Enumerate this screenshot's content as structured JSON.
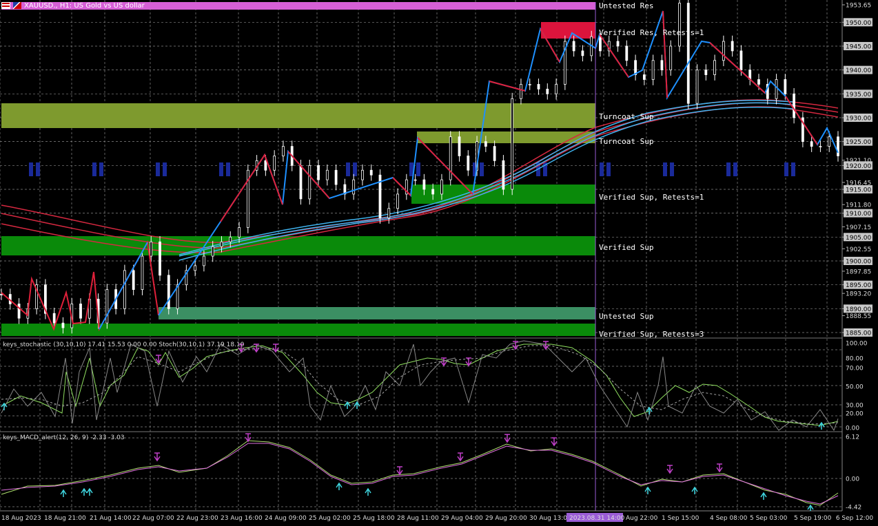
{
  "header": {
    "symbol_text": "XAUUSD., H1:  US Gold vs US dollar"
  },
  "stochastic_label": "keys_stochastic (30,10,10) 17.41 15.53 0.00 0.00  Stoch(30,10,1) 37.19 18.10",
  "macd_label": "keys_MACD_alert(12, 26, 9) -2.33 -3.03",
  "colors": {
    "up_line": "#1e90ff",
    "down_line": "#e0203a",
    "verified_sup": "#0a8a0a",
    "turncoat": "#7e9a2e",
    "untested_sup": "#3b8f63",
    "verified_res": "#dc143c",
    "untested_res": "#d65fd6"
  },
  "zone_labels": {
    "untested_res": "Untested Res",
    "verified_res": "Verified Res, Retests=1",
    "turncoat_1": "Turncoat Sup",
    "turncoat_2": "Turncoat Sup",
    "verified_sup_r1": "Verified Sup, Retests=1",
    "verified_sup": "Verified Sup",
    "untested_sup": "Untested Sup",
    "verified_sup_r3": "Verified Sup, Retests=3"
  },
  "price_axis": [
    "1953.65",
    "1950.00",
    "1945.00",
    "1940.00",
    "1935.00",
    "1930.00",
    "1925.00",
    "1921.10",
    "1920.00",
    "1916.45",
    "1915.00",
    "1911.80",
    "1910.00",
    "1907.15",
    "1905.00",
    "1902.55",
    "1900.00",
    "1897.85",
    "1895.00",
    "1893.20",
    "1890.00",
    "1888.55",
    "1885.00"
  ],
  "highlighted_prices": [
    "1950.00",
    "1945.00",
    "1940.00",
    "1935.00",
    "1930.00",
    "1925.00",
    "1920.00",
    "1915.00",
    "1910.00",
    "1905.00",
    "1900.00",
    "1895.00",
    "1890.00",
    "1885.00"
  ],
  "stoch_axis": [
    "100.00",
    "80.00",
    "70.00",
    "50.00",
    "30.00",
    "20.00",
    "0.00"
  ],
  "macd_axis": [
    "6.12",
    "0.00",
    "-4.42"
  ],
  "time_axis": [
    "18 Aug 2023",
    "18 Aug 21:00",
    "21 Aug 14:00",
    "22 Aug 07:00",
    "22 Aug 23:00",
    "23 Aug 16:00",
    "24 Aug 09:00",
    "25 Aug 02:00",
    "25 Aug 18:00",
    "28 Aug 11:00",
    "29 Aug 04:00",
    "29 Aug 20:00",
    "30 Aug 13:00",
    "2023.08.31 14:00",
    "Aug 22:00",
    "1 Sep 15:00",
    "4 Sep 08:00",
    "5 Sep 03:00",
    "5 Sep 19:00",
    "6 Sep 12:00"
  ],
  "cursor_time": "2023.08.31 14:00",
  "price_series": [
    1893,
    1891,
    1888,
    1890,
    1895,
    1889,
    1887,
    1886,
    1891,
    1888,
    1892,
    1887,
    1894,
    1890,
    1898,
    1894,
    1901,
    1904,
    1897,
    1890,
    1895,
    1898,
    1899,
    1901,
    1903,
    1904,
    1905,
    1907,
    1919,
    1921,
    1919,
    1922,
    1924,
    1920,
    1913,
    1920,
    1917,
    1919,
    1916,
    1914,
    1917,
    1919,
    1918,
    1909,
    1911,
    1914,
    1917,
    1917,
    1915,
    1914,
    1917,
    1926,
    1922,
    1919,
    1925,
    1924,
    1921,
    1915,
    1934,
    1937,
    1937,
    1936,
    1935,
    1937,
    1946,
    1944,
    1943,
    1947,
    1944,
    1946,
    1945,
    1942,
    1939,
    1938,
    1942,
    1940,
    1945,
    1954,
    1933,
    1940,
    1939,
    1942,
    1946,
    1944,
    1940,
    1938,
    1937,
    1934,
    1938,
    1935,
    1930,
    1925,
    1924,
    1924,
    1926,
    1922
  ]
}
